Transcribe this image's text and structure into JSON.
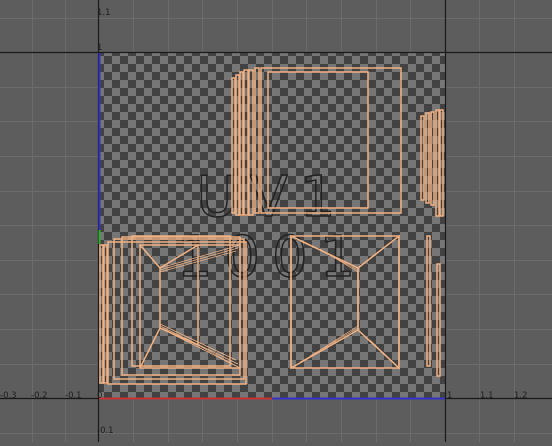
{
  "viewport": {
    "axis_labels": {
      "y_top": "1.1",
      "y_one": "1",
      "y_bottom": "-0.1",
      "x_ticks": [
        "-0.3",
        "-0.2",
        "-0.1",
        "0",
        "1",
        "1.1",
        "1.2"
      ]
    },
    "tile": {
      "line1": "UV1",
      "line2": "1001"
    },
    "colors": {
      "background": "#5d5d5d",
      "grid": "#6b6b6b",
      "frame": "#1a1a1a",
      "checker_dark": "#3d3d3d",
      "checker_light": "#7a7a7a",
      "uv_edges": "#f2b182",
      "u_axis": "#c83232",
      "v_axis": "#3232c8"
    }
  }
}
